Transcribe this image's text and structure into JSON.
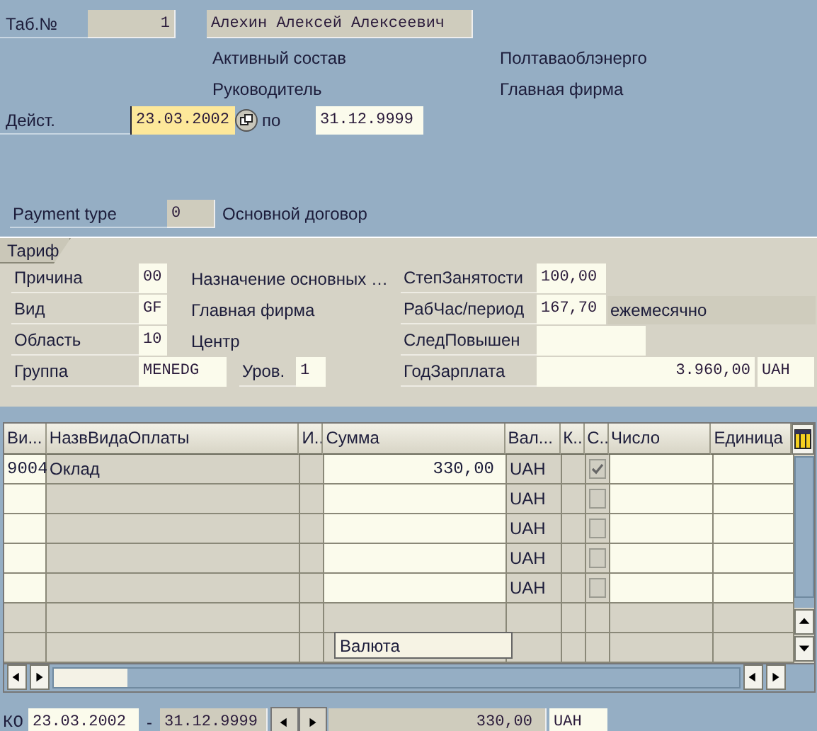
{
  "header": {
    "personnel_label": "Таб.№",
    "personnel_number": "1",
    "employee_name": "Алехин Алексей Алексеевич",
    "status": "Активный состав",
    "company": "Полтаваоблэнерго",
    "position": "Руководитель",
    "company_kind": "Главная фирма",
    "valid_label": "Дейст.",
    "valid_from": "23.03.2002",
    "to_label": "по",
    "valid_to": "31.12.9999"
  },
  "payment_type": {
    "label": "Payment type",
    "code": "0",
    "text": "Основной договор"
  },
  "tariff": {
    "title": "Тариф",
    "rows": [
      {
        "label": "Причина",
        "value": "00",
        "text": "Назначение основных …",
        "right_label": "СтепЗанятости",
        "right_value": "100,00"
      },
      {
        "label": "Вид",
        "value": "GF",
        "text": "Главная фирма",
        "right_label": "РабЧас/период",
        "right_value": "167,70",
        "right_text": "ежемесячно"
      },
      {
        "label": "Область",
        "value": "10",
        "text": "Центр",
        "right_label": "СледПовышен"
      },
      {
        "label": "Группа",
        "value": "MENEDG",
        "sub_label": "Уров.",
        "sub_value": "1",
        "right_label": "ГодЗарплата",
        "right_value": "3.960,00",
        "right_unit": "UAH"
      }
    ]
  },
  "table": {
    "columns": [
      "Ви...",
      "НазвВидаОплаты",
      "И..",
      "Сумма",
      "Вал...",
      "К..",
      "С..",
      "Число",
      "Единица"
    ],
    "rows": [
      {
        "wage_type": "9004",
        "name": "Оклад",
        "amount": "330,00",
        "currency": "UAH",
        "checked": true
      },
      {
        "currency": "UAH",
        "checked": false
      },
      {
        "currency": "UAH",
        "checked": false
      },
      {
        "currency": "UAH",
        "checked": false
      },
      {
        "currency": "UAH",
        "checked": false
      }
    ],
    "tooltip": "Валюта"
  },
  "footer": {
    "label": "КО",
    "from": "23.03.2002",
    "separator": "-",
    "to": "31.12.9999",
    "amount": "330,00",
    "currency": "UAH"
  }
}
